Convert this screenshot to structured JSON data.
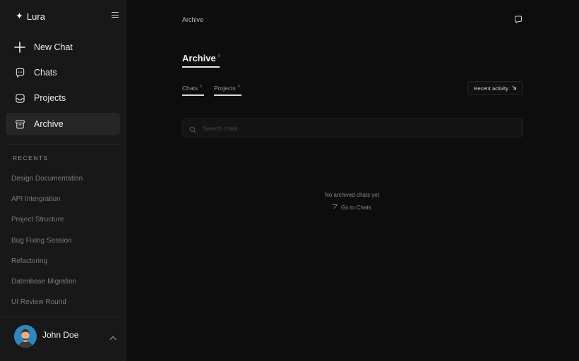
{
  "sidebar": {
    "brand": "Lura",
    "nav": [
      {
        "label": "New Chat",
        "icon": "plus-icon"
      },
      {
        "label": "Chats",
        "icon": "chat-bubble-icon"
      },
      {
        "label": "Projects",
        "icon": "inbox-icon"
      },
      {
        "label": "Archive",
        "icon": "archive-box-icon",
        "active": true
      }
    ],
    "recents_title": "RECENTS",
    "recents": [
      "Design Documentation",
      "API Intergration",
      "Project Structure",
      "Bug Fixing Session",
      "Refactoring",
      "Datenbase Migration",
      "UI Review Round"
    ],
    "user": {
      "name": "John Doe"
    }
  },
  "header": {
    "breadcrumb": "Archive"
  },
  "main": {
    "title": "Archive",
    "title_count": "0",
    "tabs": [
      {
        "label": "Chats",
        "count": "0"
      },
      {
        "label": "Projects",
        "count": "0"
      }
    ],
    "sort": {
      "label": "Recent activity"
    },
    "search": {
      "placeholder": "Search chats"
    },
    "empty_message": "No archived chats yet",
    "goto_label": "Go to Chats"
  },
  "colors": {
    "background": "#0d0d0d",
    "sidebar": "#181818",
    "active_item": "#262626"
  }
}
